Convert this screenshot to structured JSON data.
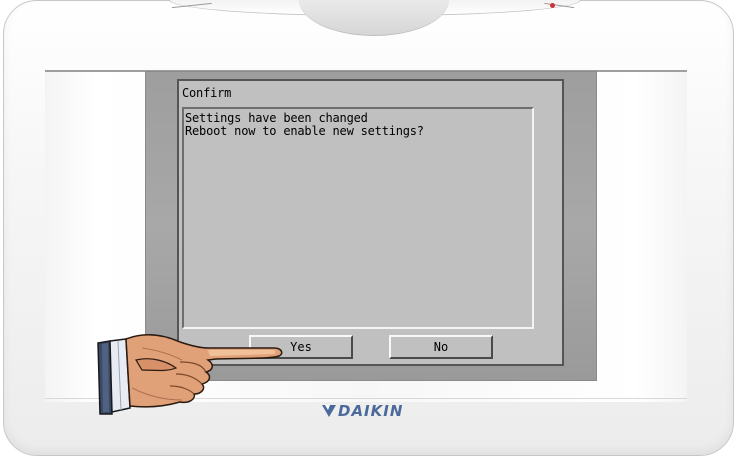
{
  "dialog": {
    "title": "Confirm",
    "message_lines": [
      "Settings have been changed",
      "Reboot now to enable new settings?"
    ],
    "buttons": {
      "yes": "Yes",
      "no": "No"
    }
  },
  "brand": {
    "logo_text": "DAIKIN",
    "logo_color": "#4b6a9b"
  },
  "icons": {
    "pointer": "pointing-hand-icon",
    "logo": "daikin-logo-icon"
  }
}
